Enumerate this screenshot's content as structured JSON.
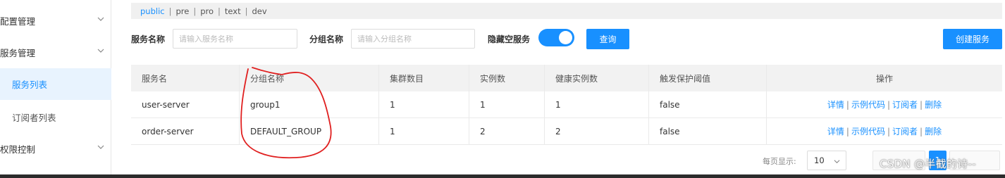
{
  "sidebar": {
    "items": [
      {
        "label": "配置管理"
      },
      {
        "label": "服务管理"
      },
      {
        "label": "服务列表"
      },
      {
        "label": "订阅者列表"
      },
      {
        "label": "权限控制"
      }
    ]
  },
  "namespaces": [
    "public",
    "pre",
    "pro",
    "text",
    "dev"
  ],
  "filters": {
    "service_label": "服务名称",
    "service_placeholder": "请输入服务名称",
    "group_label": "分组名称",
    "group_placeholder": "请输入分组名称",
    "hide_empty_label": "隐藏空服务",
    "hide_empty_on": true,
    "query_button": "查询",
    "create_button": "创建服务"
  },
  "table": {
    "columns": [
      "服务名",
      "分组名称",
      "集群数目",
      "实例数",
      "健康实例数",
      "触发保护阈值",
      "操作"
    ],
    "rows": [
      {
        "name": "user-server",
        "group": "group1",
        "clusters": "1",
        "instances": "1",
        "healthy": "1",
        "threshold": "false"
      },
      {
        "name": "order-server",
        "group": "DEFAULT_GROUP",
        "clusters": "1",
        "instances": "2",
        "healthy": "2",
        "threshold": "false"
      }
    ],
    "operations": [
      "详情",
      "示例代码",
      "订阅者",
      "删除"
    ],
    "op_separator": "|"
  },
  "pagination": {
    "page_size_label": "每页显示:",
    "page_size": "10",
    "current_page": "1"
  },
  "watermark": "CSDN @半截的诗--",
  "colors": {
    "accent": "#1890ff",
    "annotation": "#e02020"
  }
}
